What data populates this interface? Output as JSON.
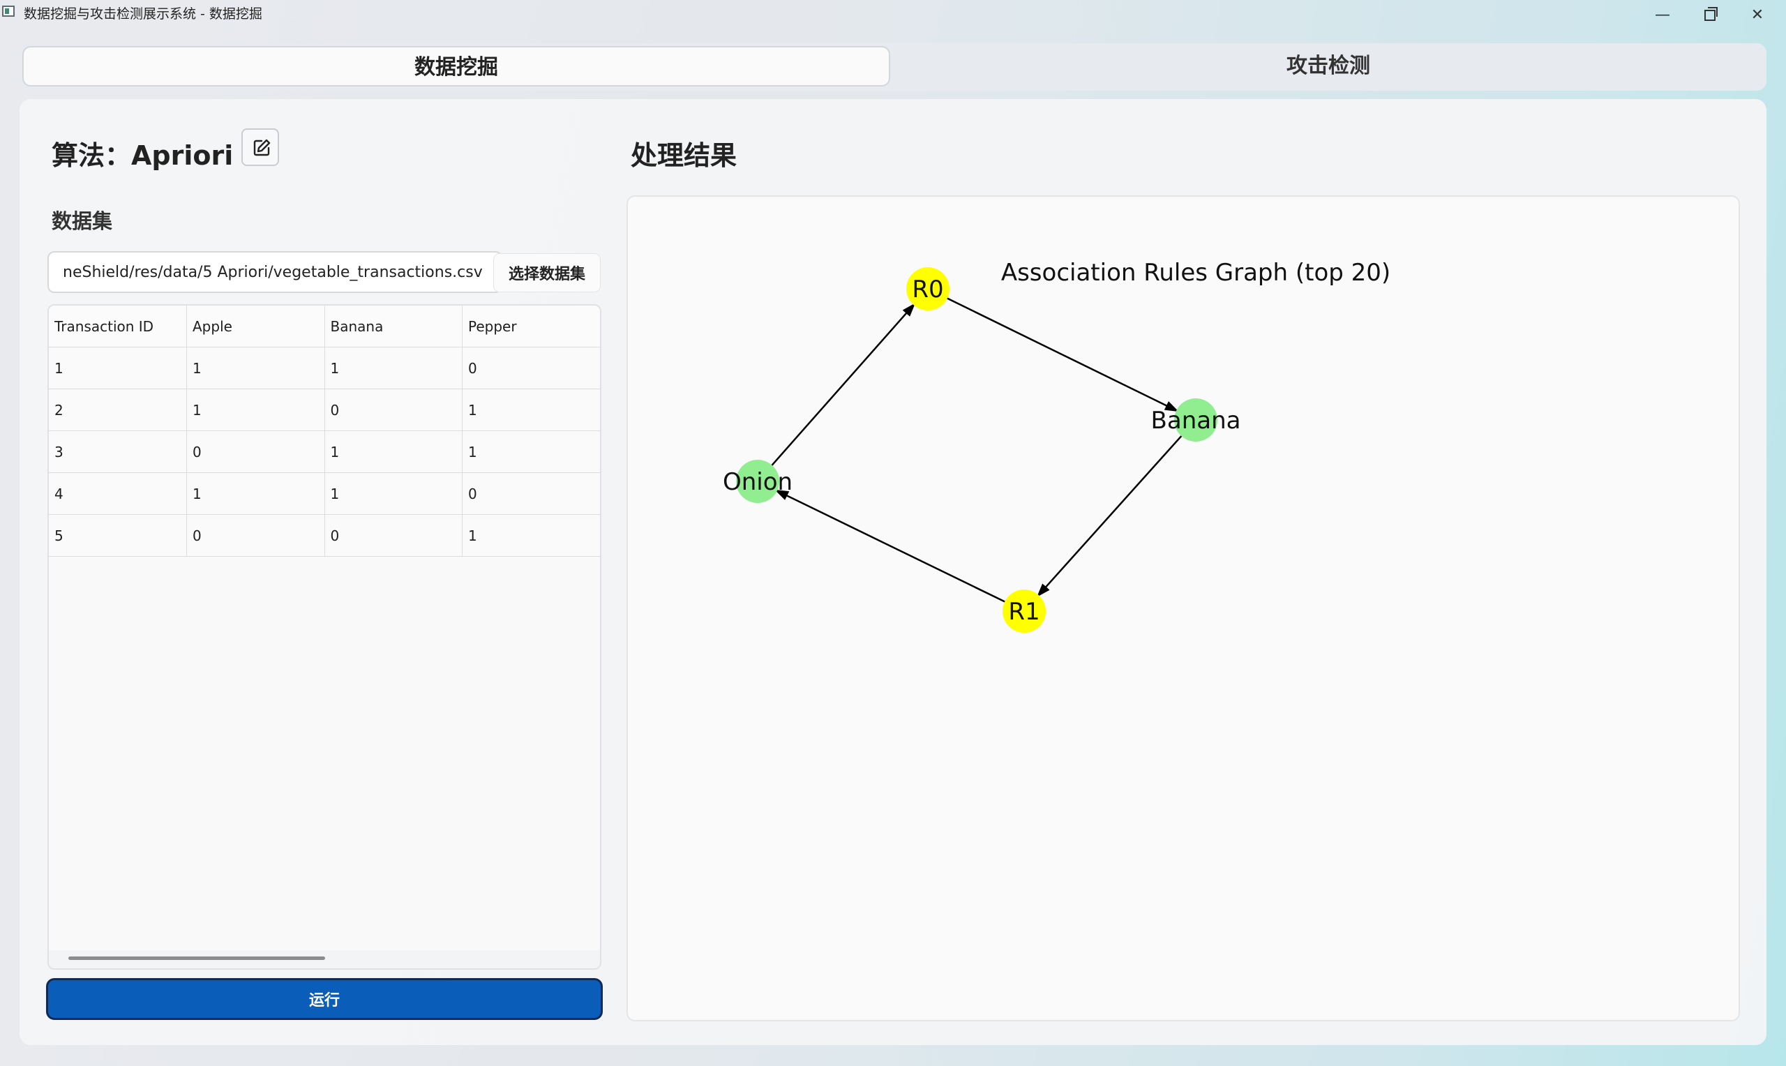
{
  "window": {
    "title": "数据挖掘与攻击检测展示系统 - 数据挖掘",
    "minimize_glyph": "—",
    "close_glyph": "✕"
  },
  "tabs": [
    {
      "label": "数据挖掘",
      "active": true
    },
    {
      "label": "攻击检测",
      "active": false
    }
  ],
  "left": {
    "algorithm_label": "算法：Apriori",
    "dataset_label": "数据集",
    "dataset_path": "neShield/res/data/5 Apriori/vegetable_transactions.csv",
    "select_button": "选择数据集",
    "table": {
      "columns": [
        "Transaction ID",
        "Apple",
        "Banana",
        "Pepper"
      ],
      "rows": [
        [
          "1",
          "1",
          "1",
          "0"
        ],
        [
          "2",
          "1",
          "0",
          "1"
        ],
        [
          "3",
          "0",
          "1",
          "1"
        ],
        [
          "4",
          "1",
          "1",
          "0"
        ],
        [
          "5",
          "0",
          "0",
          "1"
        ]
      ]
    },
    "run_button": "运行"
  },
  "right": {
    "result_label": "处理结果",
    "graph": {
      "title": "Association Rules Graph (top 20)",
      "nodes": [
        {
          "id": "R0",
          "kind": "rule",
          "color": "#ffff00"
        },
        {
          "id": "Banana",
          "kind": "item",
          "color": "#90ee90"
        },
        {
          "id": "R1",
          "kind": "rule",
          "color": "#ffff00"
        },
        {
          "id": "Onion",
          "kind": "item",
          "color": "#90ee90"
        }
      ],
      "edges": [
        {
          "from": "Onion",
          "to": "R0"
        },
        {
          "from": "R0",
          "to": "Banana"
        },
        {
          "from": "Banana",
          "to": "R1"
        },
        {
          "from": "R1",
          "to": "Onion"
        }
      ]
    }
  },
  "colors": {
    "accent": "#0a5db8",
    "rule_node": "#ffff00",
    "item_node": "#90ee90"
  }
}
